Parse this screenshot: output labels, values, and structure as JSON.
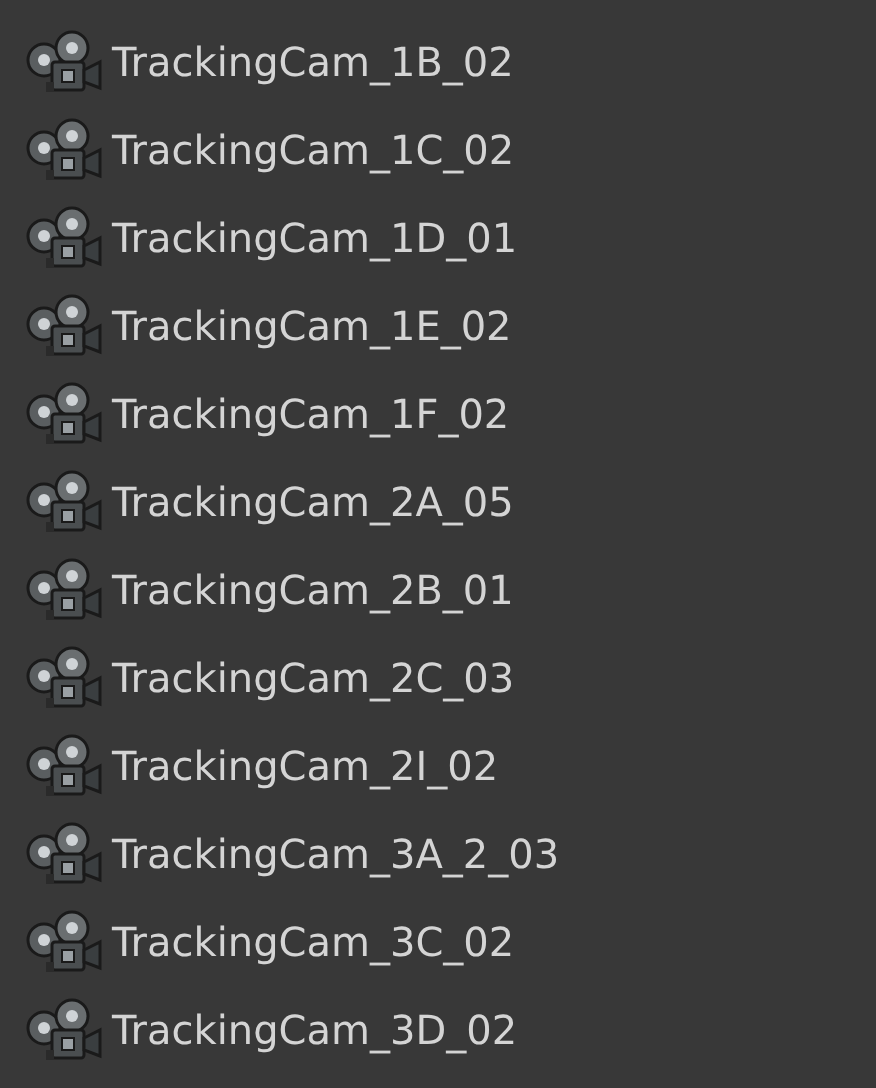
{
  "items": [
    {
      "label": "TrackingCam_1B_02"
    },
    {
      "label": "TrackingCam_1C_02"
    },
    {
      "label": "TrackingCam_1D_01"
    },
    {
      "label": "TrackingCam_1E_02"
    },
    {
      "label": "TrackingCam_1F_02"
    },
    {
      "label": "TrackingCam_2A_05"
    },
    {
      "label": "TrackingCam_2B_01"
    },
    {
      "label": "TrackingCam_2C_03"
    },
    {
      "label": "TrackingCam_2I_02"
    },
    {
      "label": "TrackingCam_3A_2_03"
    },
    {
      "label": "TrackingCam_3C_02"
    },
    {
      "label": "TrackingCam_3D_02"
    }
  ]
}
